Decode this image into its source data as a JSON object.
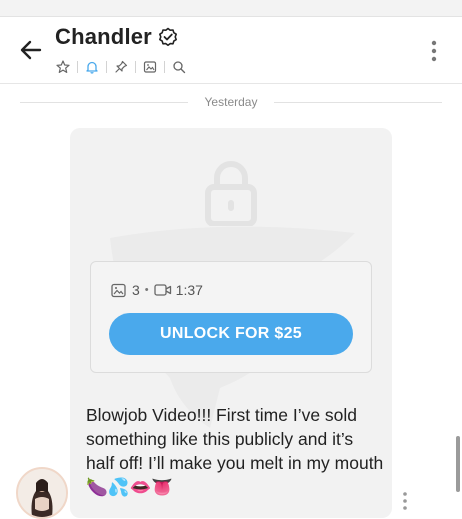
{
  "header": {
    "contact_name": "Chandler",
    "toolbar_icons": [
      "star-icon",
      "bell-icon",
      "pin-icon",
      "image-icon",
      "search-icon"
    ]
  },
  "divider": {
    "label": "Yesterday"
  },
  "message": {
    "media": {
      "photo_count": "3",
      "separator": "•",
      "video_duration": "1:37"
    },
    "unlock_label": "UNLOCK FOR $25",
    "text": "Blowjob Video!!! First time I’ve sold something like this publicly and it’s half off! I’ll make you melt in my mouth 🍆💦👄👅"
  },
  "colors": {
    "accent": "#4aa9ec",
    "bell_active": "#4aa9ec",
    "card_bg": "#f2f2f2"
  }
}
